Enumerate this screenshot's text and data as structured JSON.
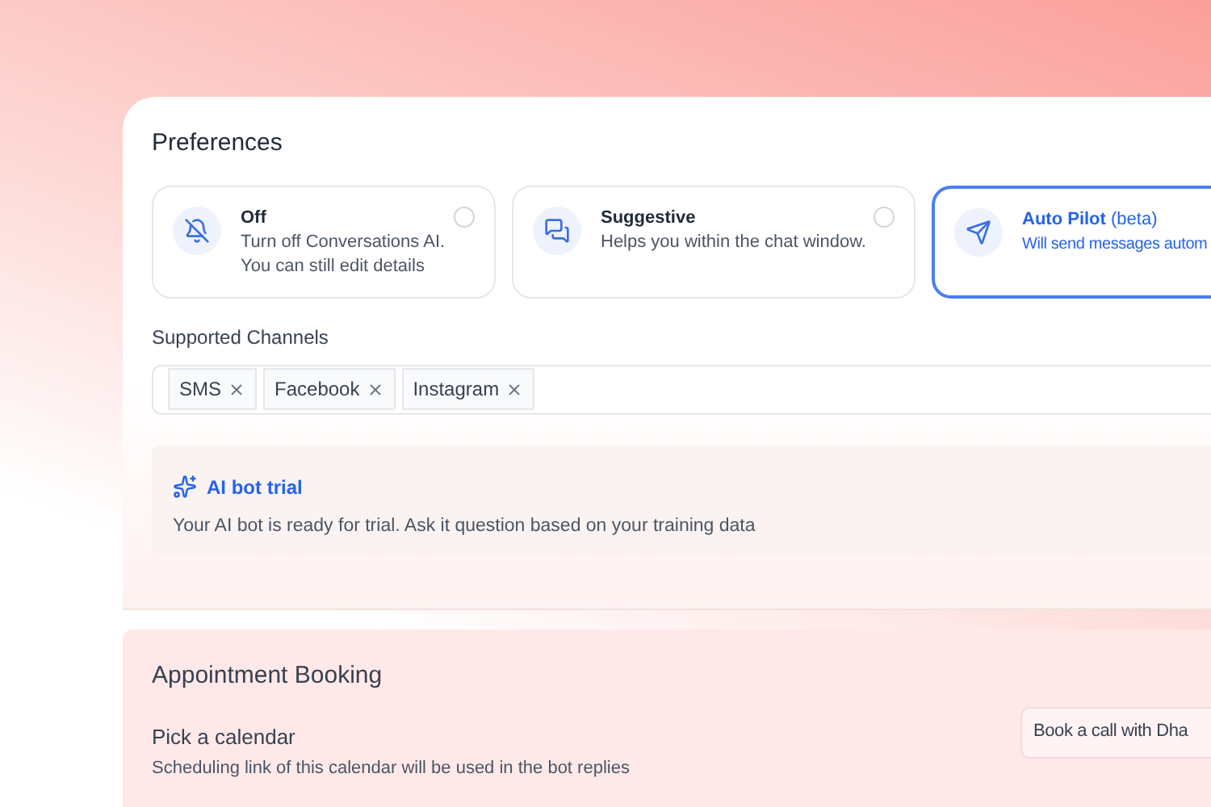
{
  "preferences": {
    "title": "Preferences",
    "modes": [
      {
        "kind": "off",
        "title": "Off",
        "description": "Turn off Conversations AI.",
        "description_2": "You can still edit details",
        "selected": false
      },
      {
        "kind": "suggestive",
        "title": "Suggestive",
        "description": "Helps you within the chat window.",
        "selected": false
      },
      {
        "kind": "autopilot",
        "title": "Auto Pilot",
        "suffix": "(beta)",
        "description": "Will send messages autom",
        "selected": true
      }
    ],
    "channels_label": "Supported Channels",
    "channels": [
      "SMS",
      "Facebook",
      "Instagram"
    ],
    "trial": {
      "title": "AI bot trial",
      "text": "Your AI bot is ready for trial. Ask it question based on your training data"
    }
  },
  "appointment": {
    "title": "Appointment Booking",
    "calendar_label": "Pick a calendar",
    "calendar_help": "Scheduling link of this calendar will be used in the bot replies",
    "calendar_value": "Book a call with Dha"
  }
}
